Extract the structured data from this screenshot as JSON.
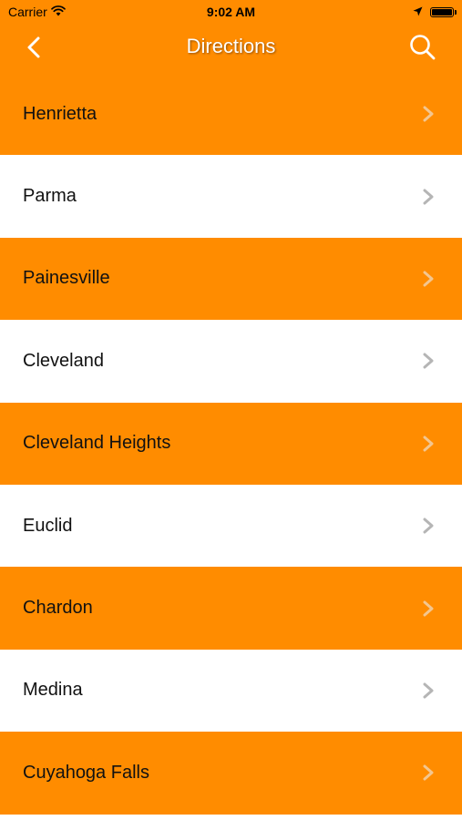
{
  "colors": {
    "accent": "#ff8c00",
    "row_alt": "#ffffff",
    "title_text": "#ffffff",
    "chevron_on_orange": "#f3c690",
    "chevron_on_white": "#b5b5b5"
  },
  "status_bar": {
    "carrier": "Carrier",
    "time": "9:02 AM",
    "icons": [
      "wifi-icon",
      "location-arrow-icon",
      "battery-icon"
    ]
  },
  "nav": {
    "title": "Directions",
    "back_icon": "chevron-left-icon",
    "search_icon": "search-icon"
  },
  "list": {
    "items": [
      {
        "label": "Henrietta",
        "style": "orange"
      },
      {
        "label": "Parma",
        "style": "white"
      },
      {
        "label": "Painesville",
        "style": "orange"
      },
      {
        "label": "Cleveland",
        "style": "white"
      },
      {
        "label": "Cleveland Heights",
        "style": "orange"
      },
      {
        "label": "Euclid",
        "style": "white"
      },
      {
        "label": "Chardon",
        "style": "orange"
      },
      {
        "label": "Medina",
        "style": "white"
      },
      {
        "label": "Cuyahoga Falls",
        "style": "orange"
      }
    ]
  }
}
